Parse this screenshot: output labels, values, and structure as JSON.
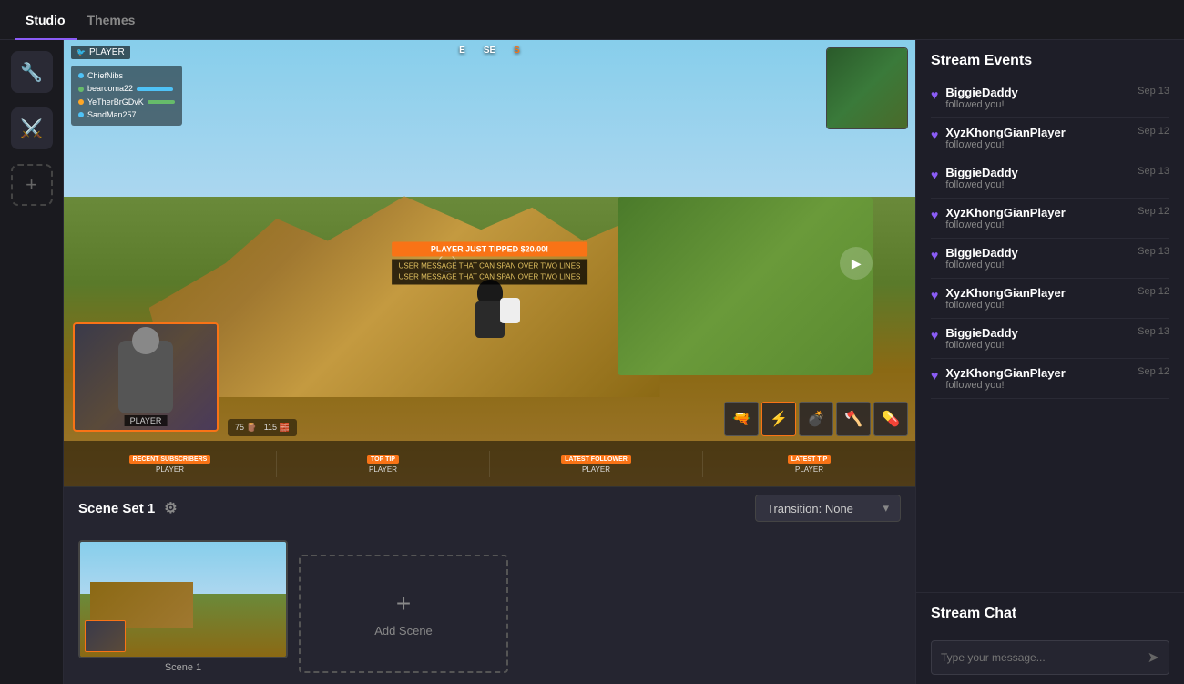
{
  "app": {
    "title": "Studio"
  },
  "nav": {
    "tabs": [
      {
        "id": "studio",
        "label": "Studio",
        "active": true
      },
      {
        "id": "themes",
        "label": "Themes",
        "active": false
      }
    ]
  },
  "sidebar": {
    "icons": [
      {
        "id": "wrench-icon",
        "symbol": "🔧"
      },
      {
        "id": "sword-icon",
        "symbol": "⚔️"
      },
      {
        "id": "add-icon",
        "symbol": "+"
      }
    ]
  },
  "preview": {
    "player_label": "PLAYER",
    "play_button": "▶",
    "compass_directions": [
      "E",
      "SE",
      "S"
    ],
    "notification": {
      "tip_label": "PLAYER JUST TIPPED $20.00!",
      "message_line1": "USER MESSAGE THAT CAN SPAN OVER TWO LINES",
      "message_line2": "USER MESSAGE THAT CAN SPAN OVER TWO LINES"
    },
    "webcam_label": "PLAYER",
    "hud_sections": [
      {
        "label": "RECENT SUBSCRIBERS",
        "value": "PLAYER"
      },
      {
        "label": "TOP TIP",
        "value": "PLAYER"
      },
      {
        "label": "LATEST FOLLOWER",
        "value": "PLAYER"
      },
      {
        "label": "LATEST TIP",
        "value": "PLAYER"
      }
    ]
  },
  "scene_set": {
    "title": "Scene Set 1",
    "transition_label": "Transition: None",
    "transition_value": "None"
  },
  "scenes": [
    {
      "id": "scene-1",
      "label": "Scene 1"
    }
  ],
  "add_scene": {
    "label": "Add Scene",
    "plus": "+"
  },
  "stream_events": {
    "title": "Stream Events",
    "events": [
      {
        "username": "BiggieDaddy",
        "action": "followed you!",
        "date": "Sep 13"
      },
      {
        "username": "XyzKhongGianPlayer",
        "action": "followed you!",
        "date": "Sep 12"
      },
      {
        "username": "BiggieDaddy",
        "action": "followed you!",
        "date": "Sep 13"
      },
      {
        "username": "XyzKhongGianPlayer",
        "action": "followed you!",
        "date": "Sep 12"
      },
      {
        "username": "BiggieDaddy",
        "action": "followed you!",
        "date": "Sep 13"
      },
      {
        "username": "XyzKhongGianPlayer",
        "action": "followed you!",
        "date": "Sep 12"
      },
      {
        "username": "BiggieDaddy",
        "action": "followed you!",
        "date": "Sep 13"
      },
      {
        "username": "XyzKhongGianPlayer",
        "action": "followed you!",
        "date": "Sep 12"
      }
    ]
  },
  "stream_chat": {
    "title": "Stream Chat",
    "input_placeholder": "Type your message..."
  }
}
